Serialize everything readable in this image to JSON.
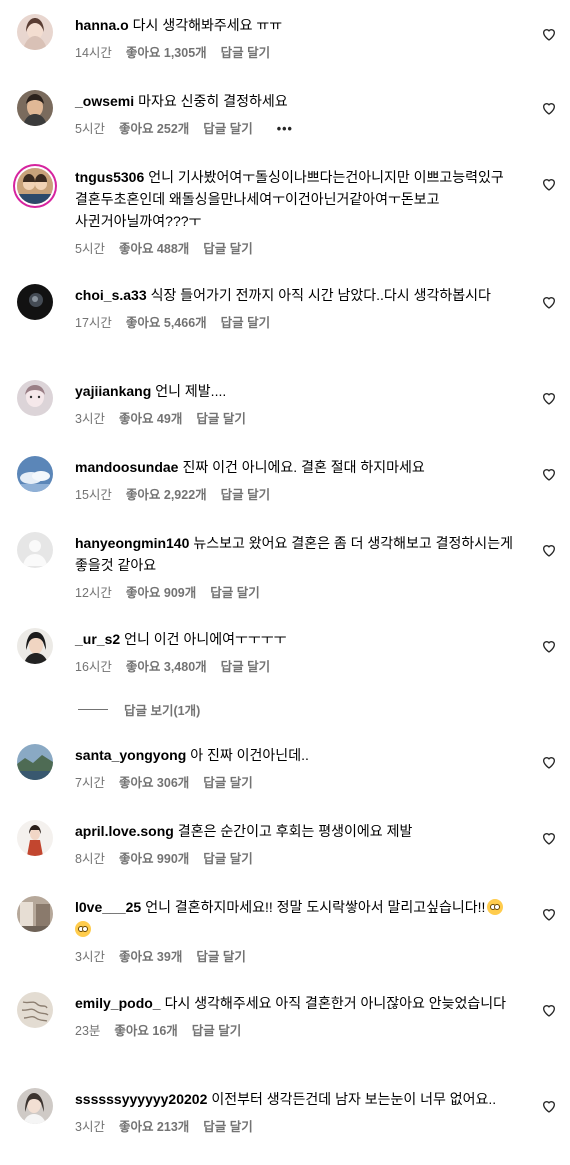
{
  "comments": [
    {
      "username": "hanna.o",
      "text": "다시 생각해봐주세요 ㅠㅠ",
      "time": "14시간",
      "likes": "좋아요 1,305개",
      "reply": "답글 달기"
    },
    {
      "username": "_owsemi",
      "text": "마자요 신중히 결정하세요",
      "time": "5시간",
      "likes": "좋아요 252개",
      "reply": "답글 달기",
      "more": "•••"
    },
    {
      "username": "tngus5306",
      "text": "언니 기사봤어여ㅜ돌싱이나쁘다는건아니지만 이쁘고능력있구 결혼두초혼인데 왜돌싱을만나세여ㅜ이건아닌거같아여ㅜ돈보고 사귄거아닐까여???ㅜ",
      "time": "5시간",
      "likes": "좋아요 488개",
      "reply": "답글 달기"
    },
    {
      "username": "choi_s.a33",
      "text": "식장 들어가기 전까지 아직 시간 남았다..다시 생각하봅시다",
      "time": "17시간",
      "likes": "좋아요 5,466개",
      "reply": "답글 달기"
    },
    {
      "username": "yajiiankang",
      "text": "언니 제발....",
      "time": "3시간",
      "likes": "좋아요 49개",
      "reply": "답글 달기"
    },
    {
      "username": "mandoosundae",
      "text": "진짜 이건 아니에요. 결혼 절대 하지마세요",
      "time": "15시간",
      "likes": "좋아요 2,922개",
      "reply": "답글 달기"
    },
    {
      "username": "hanyeongmin140",
      "text": "뉴스보고 왔어요 결혼은 좀 더 생각해보고 결정하시는게 좋을것 같아요",
      "time": "12시간",
      "likes": "좋아요 909개",
      "reply": "답글 달기"
    },
    {
      "username": "_ur_s2",
      "text": "언니 이건 아니에여ㅜㅜㅜㅜ",
      "time": "16시간",
      "likes": "좋아요 3,480개",
      "reply": "답글 달기"
    },
    {
      "username": "santa_yongyong",
      "text": "아 진짜 이건아닌데..",
      "time": "7시간",
      "likes": "좋아요 306개",
      "reply": "답글 달기"
    },
    {
      "username": "april.love.song",
      "text": "결혼은 순간이고 후회는 평생이에요 제발",
      "time": "8시간",
      "likes": "좋아요 990개",
      "reply": "답글 달기"
    },
    {
      "username": "l0ve___25",
      "text": "언니 결혼하지마세요!! 정말 도시락쌓아서 말리고싶습니다!!",
      "emoji_text": "😳 😳",
      "time": "3시간",
      "likes": "좋아요 39개",
      "reply": "답글 달기"
    },
    {
      "username": "emily_podo_",
      "text": "다시 생각해주세요 아직 결혼한거 아니잖아요 안늦었습니다",
      "time": "23분",
      "likes": "좋아요 16개",
      "reply": "답글 달기"
    },
    {
      "username": "ssssssyyyyyy20202",
      "text": "이전부터 생각든건데 남자 보는눈이 너무 없어요..",
      "time": "3시간",
      "likes": "좋아요 213개",
      "reply": "답글 달기"
    }
  ],
  "view_replies": "답글 보기(1개)",
  "icons": {
    "heart": "heart-outline-icon",
    "more": "more-dots-icon"
  },
  "colors": {
    "meta": "#737373",
    "story_ring": "#d6249f"
  }
}
